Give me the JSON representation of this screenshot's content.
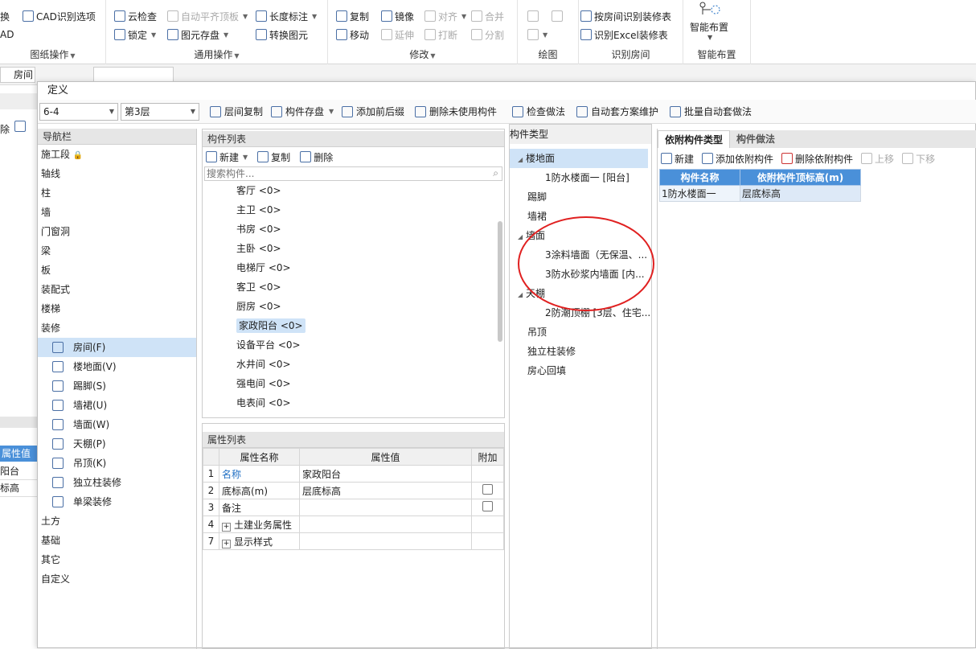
{
  "ribbon": {
    "g1": {
      "items": [
        "换",
        "CAD识别选项",
        "AD"
      ],
      "title": "图纸操作"
    },
    "g2": {
      "items": [
        "云检查",
        "自动平齐顶板",
        "长度标注",
        "锁定",
        "图元存盘",
        "转换图元"
      ],
      "title": "通用操作"
    },
    "g3": {
      "items": [
        "复制",
        "镜像",
        "对齐",
        "合并",
        "移动",
        "延伸",
        "打断",
        "分割"
      ],
      "title": "修改"
    },
    "g4": {
      "title": "绘图"
    },
    "g5": {
      "items": [
        "按房间识别装修表",
        "识别Excel装修表"
      ],
      "title": "识别房间"
    },
    "g6": {
      "items": [
        "智能布置"
      ],
      "title": "智能布置"
    }
  },
  "bar2": {
    "left_label": "房间"
  },
  "left_bg": {
    "item1": "除",
    "prop_header": "属性值",
    "v1": "阳台",
    "v2": "标高"
  },
  "window": {
    "title": "定义",
    "floor_select": "6-4",
    "layer_select": "第3层",
    "toolbar": [
      "层间复制",
      "构件存盘",
      "添加前后缀",
      "删除未使用构件",
      "检查做法",
      "自动套方案维护",
      "批量自动套做法"
    ]
  },
  "nav": {
    "header": "导航栏",
    "items": [
      "施工段",
      "轴线",
      "柱",
      "墙",
      "门窗洞",
      "梁",
      "板",
      "装配式",
      "楼梯",
      "装修"
    ],
    "sub": [
      "房间(F)",
      "楼地面(V)",
      "踢脚(S)",
      "墙裙(U)",
      "墙面(W)",
      "天棚(P)",
      "吊顶(K)",
      "独立柱装修",
      "单梁装修"
    ],
    "after": [
      "土方",
      "基础",
      "其它",
      "自定义"
    ]
  },
  "component_list": {
    "header": "构件列表",
    "new": "新建",
    "copy": "复制",
    "delete": "删除",
    "search_placeholder": "搜索构件...",
    "items": [
      "客厅 <0>",
      "主卫 <0>",
      "书房 <0>",
      "主卧 <0>",
      "电梯厅 <0>",
      "客卫 <0>",
      "厨房 <0>",
      "家政阳台 <0>",
      "设备平台 <0>",
      "水井间 <0>",
      "强电间 <0>",
      "电表间 <0>"
    ]
  },
  "property_list": {
    "header": "属性列表",
    "columns": [
      "属性名称",
      "属性值",
      "附加"
    ],
    "rows": [
      {
        "n": "1",
        "name": "名称",
        "value": "家政阳台"
      },
      {
        "n": "2",
        "name": "底标高(m)",
        "value": "层底标高"
      },
      {
        "n": "3",
        "name": "备注",
        "value": ""
      },
      {
        "n": "4",
        "name": "土建业务属性",
        "value": ""
      },
      {
        "n": "7",
        "name": "显示样式",
        "value": ""
      }
    ]
  },
  "component_types": {
    "header": "构件类型",
    "tree": [
      {
        "label": "楼地面",
        "level": 0,
        "expanded": true
      },
      {
        "label": "1防水楼面一 [阳台]",
        "level": 1
      },
      {
        "label": "踢脚",
        "level": 0
      },
      {
        "label": "墙裙",
        "level": 0
      },
      {
        "label": "墙面",
        "level": 0,
        "expanded": true
      },
      {
        "label": "3涂料墙面（无保温、...",
        "level": 1
      },
      {
        "label": "3防水砂浆内墙面 [内...",
        "level": 1
      },
      {
        "label": "天棚",
        "level": 0,
        "expanded": true
      },
      {
        "label": "2防潮顶棚 [3层、住宅...",
        "level": 1
      },
      {
        "label": "吊顶",
        "level": 0
      },
      {
        "label": "独立柱装修",
        "level": 0
      },
      {
        "label": "房心回填",
        "level": 0
      }
    ]
  },
  "attach": {
    "tab1": "依附构件类型",
    "tab2": "构件做法",
    "new": "新建",
    "add": "添加依附构件",
    "del": "删除依附构件",
    "up": "上移",
    "down": "下移",
    "columns": [
      "构件名称",
      "依附构件顶标高(m)"
    ],
    "row": [
      "1防水楼面一",
      "层底标高"
    ]
  },
  "colors": {
    "accent": "#1f6fc4",
    "selected": "#cfe3f7",
    "circle": "#e02020"
  }
}
